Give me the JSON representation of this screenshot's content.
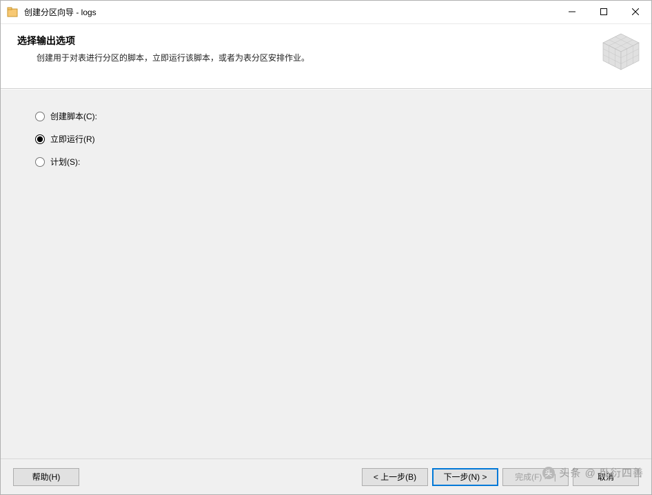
{
  "titlebar": {
    "title": "创建分区向导 - logs"
  },
  "header": {
    "heading": "选择输出选项",
    "subheading": "创建用于对表进行分区的脚本，立即运行该脚本，或者为表分区安排作业。"
  },
  "options": {
    "create_script": {
      "label": "创建脚本(C):",
      "checked": false
    },
    "run_now": {
      "label": "立即运行(R)",
      "checked": true
    },
    "schedule": {
      "label": "计划(S):",
      "checked": false
    }
  },
  "footer": {
    "help": "帮助(H)",
    "back": "< 上一步(B)",
    "next": "下一步(N) >",
    "finish": "完成(F) >>|",
    "cancel": "取消"
  },
  "watermark": "头条 @ 卧衍四善"
}
